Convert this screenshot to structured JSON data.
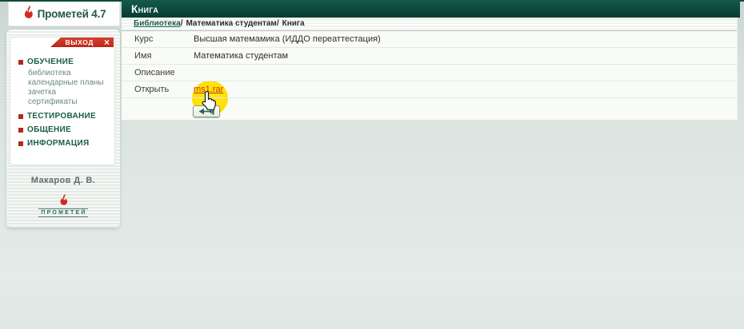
{
  "colors": {
    "header_green": "#0c4a3d",
    "accent_red": "#c62f20",
    "link_green": "#1b5e4e",
    "file_link_red": "#cc3300",
    "click_highlight_yellow": "#ffdf00"
  },
  "icons": {
    "close_glyph": "×",
    "flame": "torch-flame",
    "back_arrow": "arrow-left-to-bar",
    "click_cursor": "hand-pointer"
  },
  "logo": {
    "text": "Прометей 4.7"
  },
  "sidebar": {
    "exit": {
      "label": "ВЫХОД",
      "close_glyph": "×"
    },
    "sections": [
      {
        "label": "ОБУЧЕНИЕ"
      },
      {
        "label": "ТЕСТИРОВАНИЕ"
      },
      {
        "label": "ОБЩЕНИЕ"
      },
      {
        "label": "ИНФОРМАЦИЯ"
      }
    ],
    "obuchenie_items": [
      {
        "label": "библиотека"
      },
      {
        "label": "календарные планы"
      },
      {
        "label": "зачетка"
      },
      {
        "label": "сертификаты"
      }
    ],
    "user_name": "Макаров Д. В.",
    "footer_logo_text": "ПРОМЕТЕЙ"
  },
  "main": {
    "title": "Книга",
    "breadcrumb": {
      "separator": "/",
      "items": [
        {
          "label": "Библиотека"
        },
        {
          "label": "Математика студентам"
        },
        {
          "label": "Книга"
        }
      ]
    },
    "fields": [
      {
        "label": "Курс",
        "value": "Высшая матемамика (ИДДО переаттестация)"
      },
      {
        "label": "Имя",
        "value": "Математика студентам"
      },
      {
        "label": "Описание",
        "value": ""
      },
      {
        "label": "Открыть",
        "value": "ms1.rar"
      }
    ]
  }
}
